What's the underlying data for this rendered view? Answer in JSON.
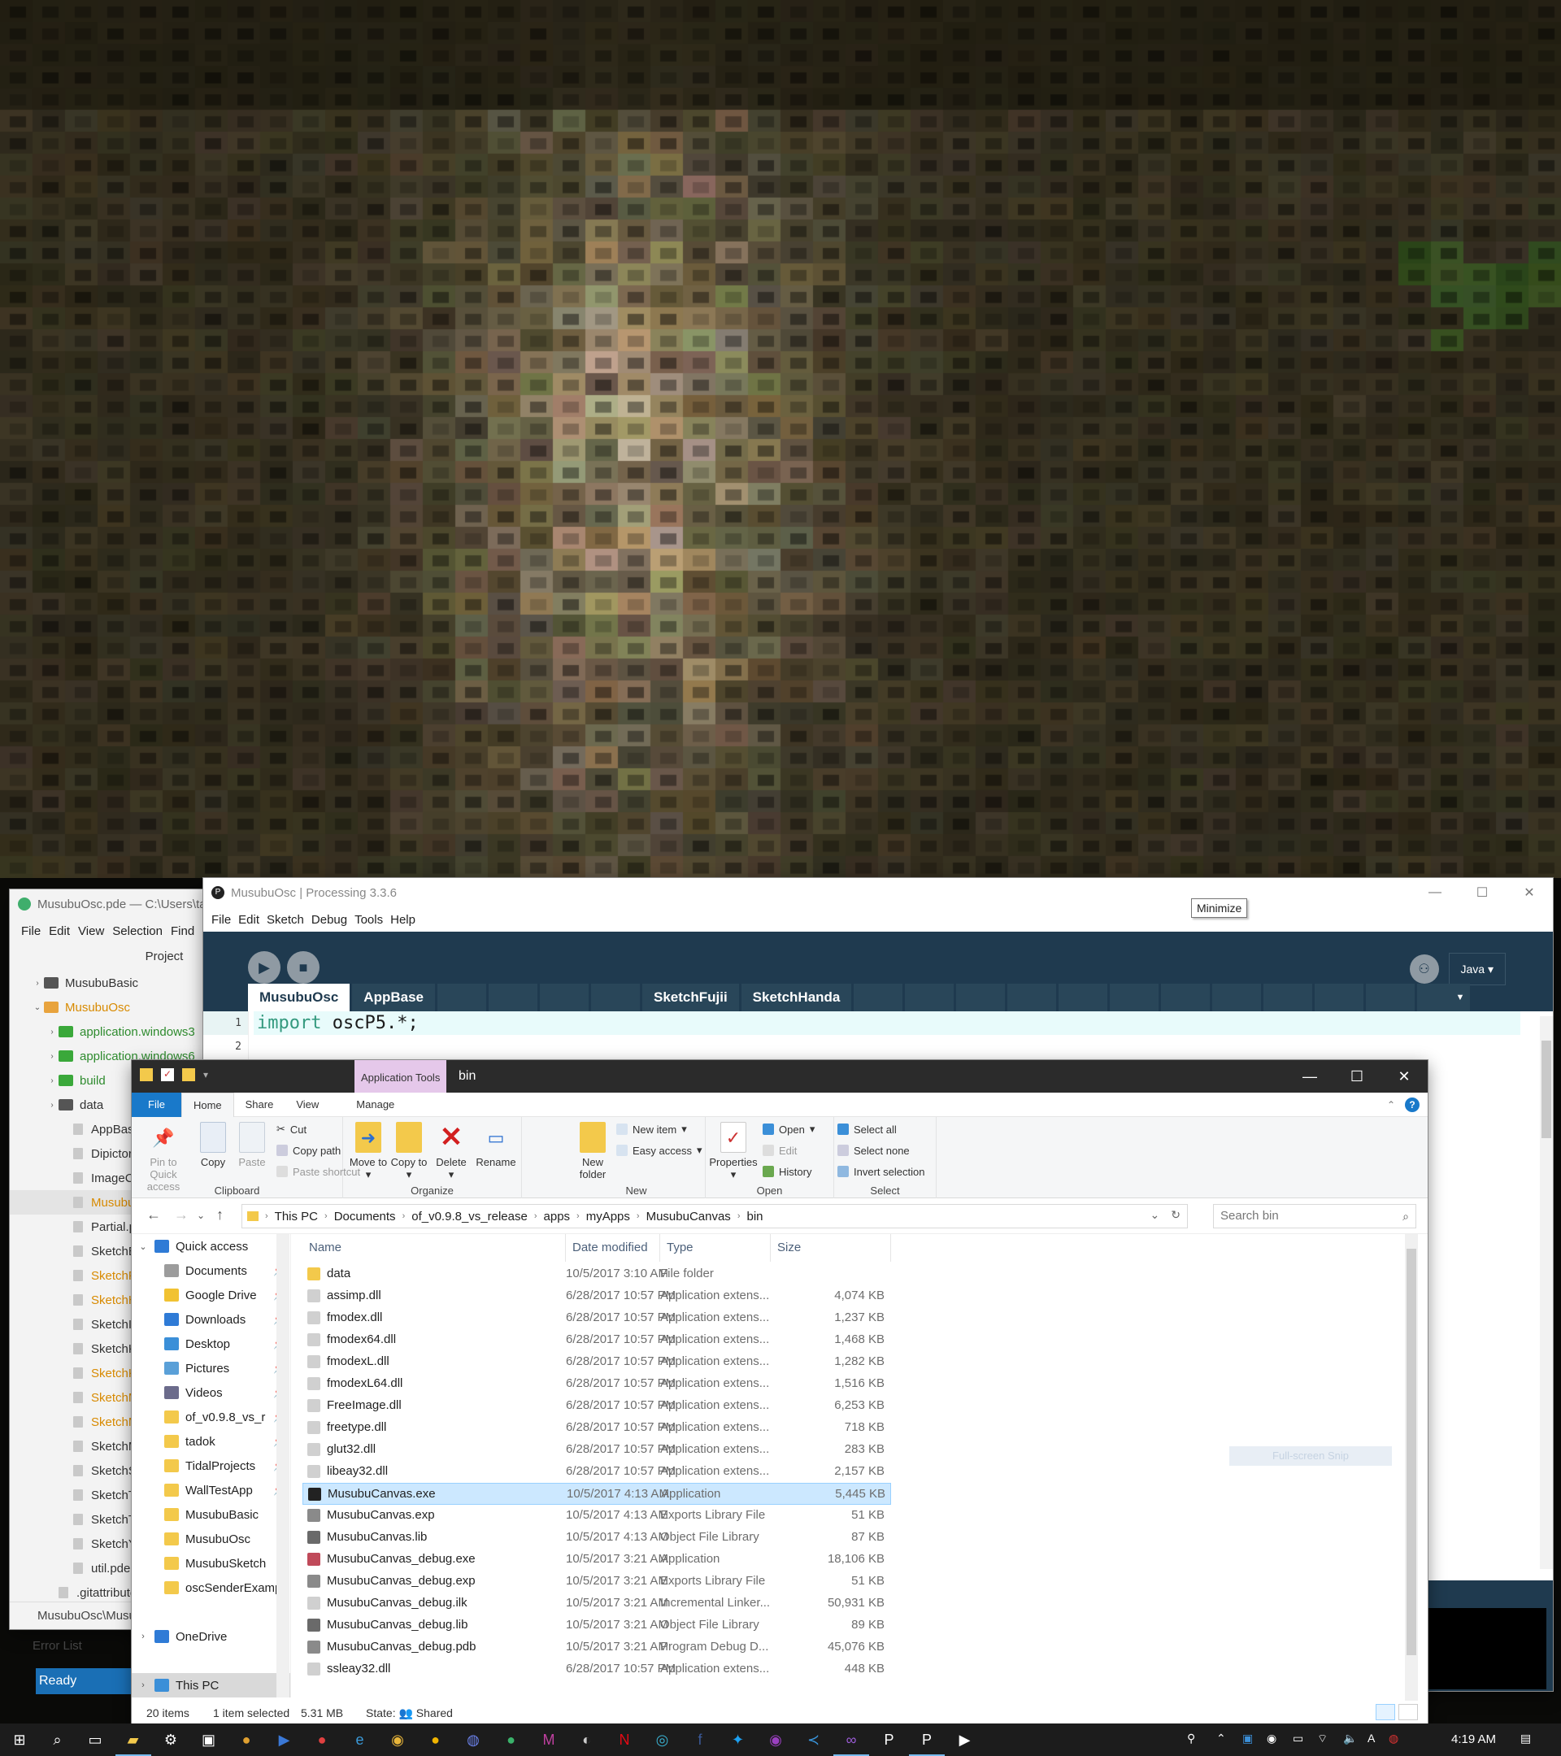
{
  "vscode": {
    "title": "MusubuOsc.pde — C:\\Users\\ta",
    "menu": [
      "File",
      "Edit",
      "View",
      "Selection",
      "Find"
    ],
    "sidebar_header": "Project",
    "tree": [
      {
        "label": "MusubuBasic",
        "kind": "folder",
        "color": "#555555",
        "depth": 0,
        "arrow": "›"
      },
      {
        "label": "MusubuOsc",
        "kind": "folder",
        "color": "#e8a33d",
        "depth": 0,
        "arrow": "⌄",
        "text": "orange"
      },
      {
        "label": "application.windows3",
        "kind": "folder",
        "color": "#3aa83a",
        "depth": 1,
        "arrow": "›",
        "text": "green"
      },
      {
        "label": "application.windows6",
        "kind": "folder",
        "color": "#3aa83a",
        "depth": 1,
        "arrow": "›",
        "text": "green"
      },
      {
        "label": "build",
        "kind": "folder",
        "color": "#3aa83a",
        "depth": 1,
        "arrow": "›",
        "text": "green"
      },
      {
        "label": "data",
        "kind": "folder",
        "color": "#555555",
        "depth": 1,
        "arrow": "›"
      },
      {
        "label": "AppBase",
        "kind": "file",
        "depth": 1
      },
      {
        "label": "Dipictor",
        "kind": "file",
        "depth": 1
      },
      {
        "label": "ImageCo",
        "kind": "file",
        "depth": 1
      },
      {
        "label": "Musubu",
        "kind": "file",
        "depth": 1,
        "text": "orange",
        "sel": true
      },
      {
        "label": "Partial.p",
        "kind": "file",
        "depth": 1
      },
      {
        "label": "SketchB",
        "kind": "file",
        "depth": 1
      },
      {
        "label": "SketchF",
        "kind": "file",
        "depth": 1,
        "text": "orange"
      },
      {
        "label": "SketchH",
        "kind": "file",
        "depth": 1,
        "text": "orange"
      },
      {
        "label": "SketchIn",
        "kind": "file",
        "depth": 1
      },
      {
        "label": "SketchK",
        "kind": "file",
        "depth": 1
      },
      {
        "label": "SketchK",
        "kind": "file",
        "depth": 1,
        "text": "orange"
      },
      {
        "label": "SketchM",
        "kind": "file",
        "depth": 1,
        "text": "orange"
      },
      {
        "label": "SketchM",
        "kind": "file",
        "depth": 1,
        "text": "orange"
      },
      {
        "label": "SketchM",
        "kind": "file",
        "depth": 1
      },
      {
        "label": "SketchS",
        "kind": "file",
        "depth": 1
      },
      {
        "label": "SketchTa",
        "kind": "file",
        "depth": 1
      },
      {
        "label": "SketchTs",
        "kind": "file",
        "depth": 1
      },
      {
        "label": "SketchYo",
        "kind": "file",
        "depth": 1
      },
      {
        "label": "util.pde",
        "kind": "file",
        "depth": 1
      },
      {
        "label": ".gitattribute",
        "kind": "file",
        "depth": 0
      }
    ],
    "status": "MusubuOsc\\Musu"
  },
  "processing": {
    "title": "MusubuOsc | Processing 3.3.6",
    "menu": [
      "File",
      "Edit",
      "Sketch",
      "Debug",
      "Tools",
      "Help"
    ],
    "mode": "Java",
    "tabs": [
      "MusubuOsc",
      "AppBase",
      "",
      "",
      "",
      "",
      "SketchFujii",
      "SketchHanda",
      "",
      "",
      "",
      "",
      "",
      "",
      "",
      "",
      "",
      "",
      "",
      ""
    ],
    "active_tab": "MusubuOsc",
    "code_keyword": "import",
    "code_rest": " oscP5.*;",
    "line_numbers": [
      "1",
      "2"
    ],
    "error_list": "Error List",
    "status": "Ready"
  },
  "tooltip": "Minimize",
  "explorer": {
    "app_tools": "Application Tools",
    "title": "bin",
    "tabs": [
      "File",
      "Home",
      "Share",
      "View",
      "Manage"
    ],
    "ribbon": {
      "clipboard": {
        "label": "Clipboard",
        "pin": "Pin to Quick access",
        "copy": "Copy",
        "paste": "Paste",
        "cut": "Cut",
        "copy_path": "Copy path",
        "paste_shortcut": "Paste shortcut"
      },
      "organize": {
        "label": "Organize",
        "move": "Move to",
        "copy": "Copy to",
        "delete": "Delete",
        "rename": "Rename"
      },
      "new": {
        "label": "New",
        "new_folder": "New folder",
        "new_item": "New item",
        "easy_access": "Easy access"
      },
      "open": {
        "label": "Open",
        "properties": "Properties",
        "open": "Open",
        "edit": "Edit",
        "history": "History"
      },
      "select": {
        "label": "Select",
        "all": "Select all",
        "none": "Select none",
        "invert": "Invert selection"
      }
    },
    "breadcrumb": [
      "This PC",
      "Documents",
      "of_v0.9.8_vs_release",
      "apps",
      "myApps",
      "MusubuCanvas",
      "bin"
    ],
    "search_placeholder": "Search bin",
    "nav": [
      {
        "label": "Quick access",
        "icon": "#2f7bd6",
        "arrow": "⌄",
        "pin": false
      },
      {
        "label": "Documents",
        "icon": "#9c9c9c",
        "pin": true
      },
      {
        "label": "Google Drive",
        "icon": "#f1c232",
        "pin": true
      },
      {
        "label": "Downloads",
        "icon": "#2f7bd6",
        "pin": true
      },
      {
        "label": "Desktop",
        "icon": "#3b8fd8",
        "pin": true
      },
      {
        "label": "Pictures",
        "icon": "#5aa0d8",
        "pin": true
      },
      {
        "label": "Videos",
        "icon": "#6b6b8b",
        "pin": true
      },
      {
        "label": "of_v0.9.8_vs_r",
        "icon": "#f3c94b",
        "pin": true
      },
      {
        "label": "tadok",
        "icon": "#f3c94b",
        "pin": true
      },
      {
        "label": "TidalProjects",
        "icon": "#f3c94b",
        "pin": true
      },
      {
        "label": "WallTestApp",
        "icon": "#f3c94b",
        "pin": true
      },
      {
        "label": "MusubuBasic",
        "icon": "#f3c94b",
        "pin": false
      },
      {
        "label": "MusubuOsc",
        "icon": "#f3c94b",
        "pin": false
      },
      {
        "label": "MusubuSketch",
        "icon": "#f3c94b",
        "pin": false
      },
      {
        "label": "oscSenderExamp",
        "icon": "#f3c94b",
        "pin": false
      },
      {
        "label": "",
        "icon": "",
        "pin": false
      },
      {
        "label": "OneDrive",
        "icon": "#2f7bd6",
        "arrow": "›",
        "pin": false
      },
      {
        "label": "",
        "icon": "",
        "pin": false
      },
      {
        "label": "This PC",
        "icon": "#3b8fd8",
        "arrow": "›",
        "pin": false,
        "grey": true
      }
    ],
    "columns": {
      "name": "Name",
      "date": "Date modified",
      "type": "Type",
      "size": "Size"
    },
    "files": [
      {
        "name": "data",
        "date": "10/5/2017 3:10 AM",
        "type": "File folder",
        "size": "",
        "icon": "#f3c94b"
      },
      {
        "name": "assimp.dll",
        "date": "6/28/2017 10:57 PM",
        "type": "Application extens...",
        "size": "4,074 KB",
        "icon": "#d0d0d0"
      },
      {
        "name": "fmodex.dll",
        "date": "6/28/2017 10:57 PM",
        "type": "Application extens...",
        "size": "1,237 KB",
        "icon": "#d0d0d0"
      },
      {
        "name": "fmodex64.dll",
        "date": "6/28/2017 10:57 PM",
        "type": "Application extens...",
        "size": "1,468 KB",
        "icon": "#d0d0d0"
      },
      {
        "name": "fmodexL.dll",
        "date": "6/28/2017 10:57 PM",
        "type": "Application extens...",
        "size": "1,282 KB",
        "icon": "#d0d0d0"
      },
      {
        "name": "fmodexL64.dll",
        "date": "6/28/2017 10:57 PM",
        "type": "Application extens...",
        "size": "1,516 KB",
        "icon": "#d0d0d0"
      },
      {
        "name": "FreeImage.dll",
        "date": "6/28/2017 10:57 PM",
        "type": "Application extens...",
        "size": "6,253 KB",
        "icon": "#d0d0d0"
      },
      {
        "name": "freetype.dll",
        "date": "6/28/2017 10:57 PM",
        "type": "Application extens...",
        "size": "718 KB",
        "icon": "#d0d0d0"
      },
      {
        "name": "glut32.dll",
        "date": "6/28/2017 10:57 PM",
        "type": "Application extens...",
        "size": "283 KB",
        "icon": "#d0d0d0"
      },
      {
        "name": "libeay32.dll",
        "date": "6/28/2017 10:57 PM",
        "type": "Application extens...",
        "size": "2,157 KB",
        "icon": "#d0d0d0"
      },
      {
        "name": "MusubuCanvas.exe",
        "date": "10/5/2017 4:13 AM",
        "type": "Application",
        "size": "5,445 KB",
        "icon": "#222222",
        "sel": true
      },
      {
        "name": "MusubuCanvas.exp",
        "date": "10/5/2017 4:13 AM",
        "type": "Exports Library File",
        "size": "51 KB",
        "icon": "#8a8a8a"
      },
      {
        "name": "MusubuCanvas.lib",
        "date": "10/5/2017 4:13 AM",
        "type": "Object File Library",
        "size": "87 KB",
        "icon": "#6a6a6a"
      },
      {
        "name": "MusubuCanvas_debug.exe",
        "date": "10/5/2017 3:21 AM",
        "type": "Application",
        "size": "18,106 KB",
        "icon": "#c04a5a"
      },
      {
        "name": "MusubuCanvas_debug.exp",
        "date": "10/5/2017 3:21 AM",
        "type": "Exports Library File",
        "size": "51 KB",
        "icon": "#8a8a8a"
      },
      {
        "name": "MusubuCanvas_debug.ilk",
        "date": "10/5/2017 3:21 AM",
        "type": "Incremental Linker...",
        "size": "50,931 KB",
        "icon": "#d0d0d0"
      },
      {
        "name": "MusubuCanvas_debug.lib",
        "date": "10/5/2017 3:21 AM",
        "type": "Object File Library",
        "size": "89 KB",
        "icon": "#6a6a6a"
      },
      {
        "name": "MusubuCanvas_debug.pdb",
        "date": "10/5/2017 3:21 AM",
        "type": "Program Debug D...",
        "size": "45,076 KB",
        "icon": "#8a8a8a"
      },
      {
        "name": "ssleay32.dll",
        "date": "6/28/2017 10:57 PM",
        "type": "Application extens...",
        "size": "448 KB",
        "icon": "#d0d0d0"
      }
    ],
    "snip_hint": "Full-screen Snip",
    "status": {
      "count": "20 items",
      "selected": "1 item selected",
      "size": "5.31 MB",
      "state": "State: 👥 Shared"
    }
  },
  "taskbar": {
    "icons": [
      {
        "name": "start-icon",
        "glyph": "⊞",
        "color": "#ffffff"
      },
      {
        "name": "search-icon",
        "glyph": "⌕",
        "color": "#ffffff"
      },
      {
        "name": "task-view-icon",
        "glyph": "▭",
        "color": "#ffffff"
      },
      {
        "name": "file-explorer-icon",
        "glyph": "▰",
        "color": "#f3c94b",
        "active": true
      },
      {
        "name": "settings-icon",
        "glyph": "⚙",
        "color": "#ffffff"
      },
      {
        "name": "store-icon",
        "glyph": "▣",
        "color": "#ffffff"
      },
      {
        "name": "paint-icon",
        "glyph": "●",
        "color": "#e0a030"
      },
      {
        "name": "powershell-icon",
        "glyph": "▶",
        "color": "#3a78d6"
      },
      {
        "name": "app-red-icon",
        "glyph": "●",
        "color": "#e04040"
      },
      {
        "name": "edge-icon",
        "glyph": "e",
        "color": "#3a9ad9"
      },
      {
        "name": "chrome-icon",
        "glyph": "◉",
        "color": "#e8b53a"
      },
      {
        "name": "app-yellow-icon",
        "glyph": "●",
        "color": "#f0b400"
      },
      {
        "name": "firefox-icon",
        "glyph": "◍",
        "color": "#6a80e8"
      },
      {
        "name": "app-green-icon",
        "glyph": "●",
        "color": "#3ab26a"
      },
      {
        "name": "app-purple-icon",
        "glyph": "M",
        "color": "#c040a0"
      },
      {
        "name": "app-mono-icon",
        "glyph": "◐",
        "color": "#cccccc"
      },
      {
        "name": "netflix-icon",
        "glyph": "N",
        "color": "#e50914"
      },
      {
        "name": "app-cyan-icon",
        "glyph": "◎",
        "color": "#3ab2d2"
      },
      {
        "name": "facebook-icon",
        "glyph": "f",
        "color": "#3b5998"
      },
      {
        "name": "twitter-icon",
        "glyph": "✦",
        "color": "#1da1f2"
      },
      {
        "name": "app-violet-icon",
        "glyph": "◉",
        "color": "#9a40c0"
      },
      {
        "name": "vscode-icon",
        "glyph": "≺",
        "color": "#3a96dd"
      },
      {
        "name": "visual-studio-icon",
        "glyph": "∞",
        "color": "#9b5cd6",
        "active": true
      },
      {
        "name": "processing-icon",
        "glyph": "P",
        "color": "#ffffff"
      },
      {
        "name": "processing-sketch-icon",
        "glyph": "P",
        "color": "#ffffff",
        "active": true
      },
      {
        "name": "media-icon",
        "glyph": "▶",
        "color": "#ffffff"
      }
    ],
    "time": "4:19 AM"
  }
}
